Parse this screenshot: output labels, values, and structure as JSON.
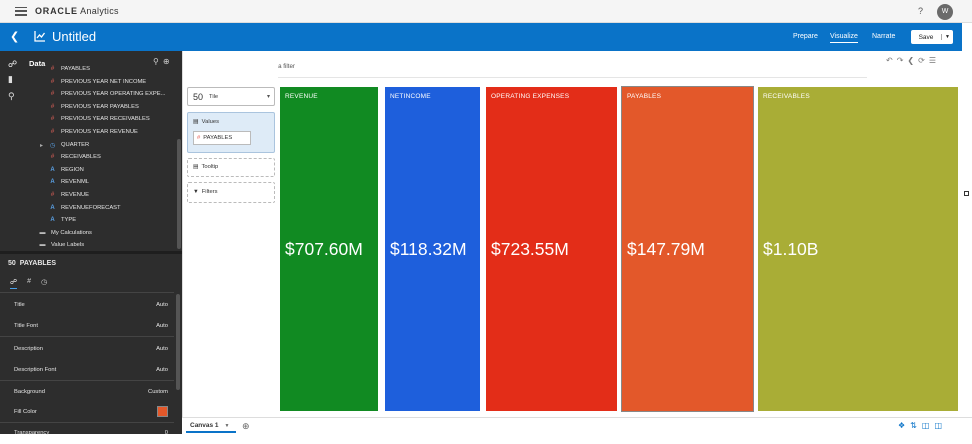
{
  "app": {
    "brand_strong": "ORACLE",
    "brand_rest": " Analytics",
    "help": "?",
    "user_initial": "W"
  },
  "header": {
    "title": "Untitled",
    "modes": [
      "Prepare",
      "Visualize",
      "Narrate"
    ],
    "active_mode": "Visualize",
    "save_label": "Save"
  },
  "data_panel": {
    "label": "Data",
    "items": [
      {
        "icon": "#",
        "type": "num",
        "label": "PAYABLES"
      },
      {
        "icon": "#",
        "type": "num",
        "label": "PREVIOUS YEAR NET INCOME"
      },
      {
        "icon": "#",
        "type": "num",
        "label": "PREVIOUS YEAR OPERATING EXPE..."
      },
      {
        "icon": "#",
        "type": "num",
        "label": "PREVIOUS YEAR PAYABLES"
      },
      {
        "icon": "#",
        "type": "num",
        "label": "PREVIOUS YEAR RECEIVABLES"
      },
      {
        "icon": "#",
        "type": "num",
        "label": "PREVIOUS YEAR REVENUE"
      },
      {
        "icon": "◷",
        "type": "time",
        "label": "QUARTER"
      },
      {
        "icon": "#",
        "type": "num",
        "label": "RECEIVABLES"
      },
      {
        "icon": "A",
        "type": "txt",
        "label": "REGION"
      },
      {
        "icon": "A",
        "type": "txt",
        "label": "REVENML"
      },
      {
        "icon": "#",
        "type": "num",
        "label": "REVENUE"
      },
      {
        "icon": "A",
        "type": "txt",
        "label": "REVENUEFORECAST"
      },
      {
        "icon": "A",
        "type": "txt",
        "label": "TYPE"
      },
      {
        "icon": "▬",
        "type": "folder",
        "label": "My Calculations"
      },
      {
        "icon": "▬",
        "type": "folder",
        "label": "Value Labels"
      }
    ]
  },
  "properties": {
    "title": "PAYABLES",
    "title_prefix": "50",
    "rows": [
      {
        "key": "Title",
        "value": "Auto"
      },
      {
        "key": "Title Font",
        "value": "Auto"
      },
      {
        "key": "Description",
        "value": "Auto"
      },
      {
        "key": "Description Font",
        "value": "Auto"
      },
      {
        "key": "Background",
        "value": "Custom"
      },
      {
        "key": "Fill Color",
        "value": "",
        "swatch": "#e3582a"
      },
      {
        "key": "Transparency",
        "value": "0"
      }
    ]
  },
  "filter_bar": {
    "placeholder": "Click here or drag data to add a filter"
  },
  "grammar": {
    "viz_type_icon": "50",
    "viz_type": "Tile",
    "values_label": "Values",
    "values_chip": "PAYABLES",
    "tooltip_label": "Tooltip",
    "filters_label": "Filters"
  },
  "tiles": [
    {
      "name": "REVENUE",
      "value": "$707.60M",
      "color": "#118a22"
    },
    {
      "name": "NETINCOME",
      "value": "$118.32M",
      "color": "#1e5fdc"
    },
    {
      "name": "OPERATING EXPENSES",
      "value": "$723.55M",
      "color": "#e32d18"
    },
    {
      "name": "PAYABLES",
      "value": "$147.79M",
      "color": "#e3582a"
    },
    {
      "name": "RECEIVABLES",
      "value": "$1.10B",
      "color": "#a9ad36"
    }
  ],
  "bottom": {
    "canvas_tab": "Canvas 1"
  },
  "colors": {
    "accent": "#0a73c8",
    "panel_dark": "#2d2d2d"
  }
}
